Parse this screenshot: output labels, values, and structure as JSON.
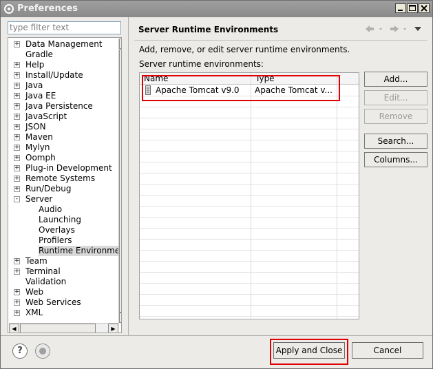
{
  "window": {
    "title": "Preferences"
  },
  "filter": {
    "placeholder": "type filter text"
  },
  "tree": {
    "items": [
      {
        "label": "Data Management",
        "expander": "+"
      },
      {
        "label": "Gradle",
        "expander": ""
      },
      {
        "label": "Help",
        "expander": "+"
      },
      {
        "label": "Install/Update",
        "expander": "+"
      },
      {
        "label": "Java",
        "expander": "+"
      },
      {
        "label": "Java EE",
        "expander": "+"
      },
      {
        "label": "Java Persistence",
        "expander": "+"
      },
      {
        "label": "JavaScript",
        "expander": "+"
      },
      {
        "label": "JSON",
        "expander": "+"
      },
      {
        "label": "Maven",
        "expander": "+"
      },
      {
        "label": "Mylyn",
        "expander": "+"
      },
      {
        "label": "Oomph",
        "expander": "+"
      },
      {
        "label": "Plug-in Development",
        "expander": "+"
      },
      {
        "label": "Remote Systems",
        "expander": "+"
      },
      {
        "label": "Run/Debug",
        "expander": "+"
      },
      {
        "label": "Server",
        "expander": "-"
      },
      {
        "label": "Audio",
        "expander": ""
      },
      {
        "label": "Launching",
        "expander": ""
      },
      {
        "label": "Overlays",
        "expander": ""
      },
      {
        "label": "Profilers",
        "expander": ""
      },
      {
        "label": "Runtime Environme",
        "expander": "",
        "selected": true
      },
      {
        "label": "Team",
        "expander": "+"
      },
      {
        "label": "Terminal",
        "expander": "+"
      },
      {
        "label": "Validation",
        "expander": ""
      },
      {
        "label": "Web",
        "expander": "+"
      },
      {
        "label": "Web Services",
        "expander": "+"
      },
      {
        "label": "XML",
        "expander": "+"
      }
    ]
  },
  "page": {
    "title": "Server Runtime Environments",
    "description": "Add, remove, or edit server runtime environments.",
    "list_label": "Server runtime environments:",
    "nav_icons": [
      "back-arrow-icon",
      "forward-arrow-icon",
      "menu-dropdown-icon"
    ]
  },
  "table": {
    "columns": [
      "Name",
      "Type"
    ],
    "rows": [
      {
        "name": "Apache Tomcat v9.0",
        "type": "Apache Tomcat v..."
      }
    ]
  },
  "buttons": {
    "add": "Add...",
    "edit": "Edit...",
    "remove": "Remove",
    "search": "Search...",
    "columns": "Columns..."
  },
  "footer": {
    "apply_close": "Apply and Close",
    "cancel": "Cancel"
  },
  "colors": {
    "highlight": "#e00000"
  }
}
